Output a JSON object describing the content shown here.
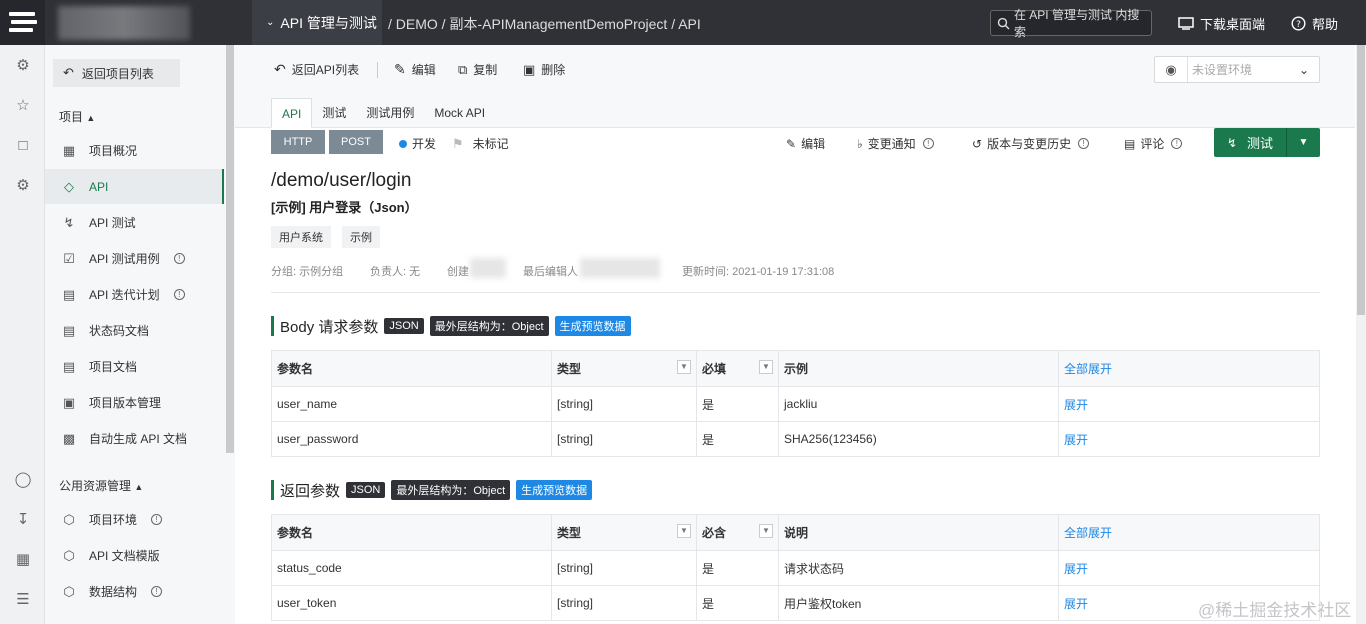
{
  "header": {
    "module": "API 管理与测试",
    "breadcrumb": "/ DEMO / 副本-APIManagementDemoProject / API",
    "search_placeholder": "在 API 管理与测试 内搜索",
    "download": "下载桌面端",
    "help": "帮助"
  },
  "sidebar": {
    "back": "返回项目列表",
    "project_group": "项目",
    "items": [
      {
        "label": "项目概况"
      },
      {
        "label": "API"
      },
      {
        "label": "API 测试"
      },
      {
        "label": "API 测试用例"
      },
      {
        "label": "API 迭代计划"
      },
      {
        "label": "状态码文档"
      },
      {
        "label": "项目文档"
      },
      {
        "label": "项目版本管理"
      },
      {
        "label": "自动生成 API 文档"
      }
    ],
    "public_group": "公用资源管理",
    "public_items": [
      {
        "label": "项目环境"
      },
      {
        "label": "API 文档模版"
      },
      {
        "label": "数据结构"
      }
    ]
  },
  "toolbar": {
    "back": "返回API列表",
    "edit": "编辑",
    "copy": "复制",
    "delete": "删除",
    "env_placeholder": "未设置环境"
  },
  "tabs": [
    "API",
    "测试",
    "测试用例",
    "Mock API"
  ],
  "api": {
    "protocol": "HTTP",
    "method": "POST",
    "status": "开发",
    "flag": "未标记",
    "actions": {
      "edit": "编辑",
      "notify": "变更通知",
      "history": "版本与变更历史",
      "comment": "评论"
    },
    "test_button": "测试",
    "path": "/demo/user/login",
    "name": "[示例] 用户登录（Json）",
    "tags": [
      "用户系统",
      "示例"
    ],
    "meta": {
      "group": "分组: 示例分组",
      "owner": "负责人: 无",
      "creator": "创建",
      "last_editor": "最后编辑人",
      "updated": "更新时间:  2021-01-19 17:31:08"
    }
  },
  "body_params": {
    "title": "Body 请求参数",
    "badge_json": "JSON",
    "badge_outer": "最外层结构为：Object",
    "badge_preview": "生成预览数据",
    "headers": [
      "参数名",
      "类型",
      "必填",
      "示例",
      "全部展开"
    ],
    "rows": [
      {
        "name": "user_name",
        "type": "[string]",
        "required": "是",
        "example": "jackliu",
        "action": "展开"
      },
      {
        "name": "user_password",
        "type": "[string]",
        "required": "是",
        "example": "SHA256(123456)",
        "action": "展开"
      }
    ]
  },
  "response_params": {
    "title": "返回参数",
    "badge_json": "JSON",
    "badge_outer": "最外层结构为：Object",
    "badge_preview": "生成预览数据",
    "headers": [
      "参数名",
      "类型",
      "必含",
      "说明",
      "全部展开"
    ],
    "rows": [
      {
        "name": "status_code",
        "type": "[string]",
        "required": "是",
        "desc": "请求状态码",
        "action": "展开"
      },
      {
        "name": "user_token",
        "type": "[string]",
        "required": "是",
        "desc": "用户鉴权token",
        "action": "展开"
      }
    ]
  },
  "watermark": "@稀土掘金技术社区"
}
